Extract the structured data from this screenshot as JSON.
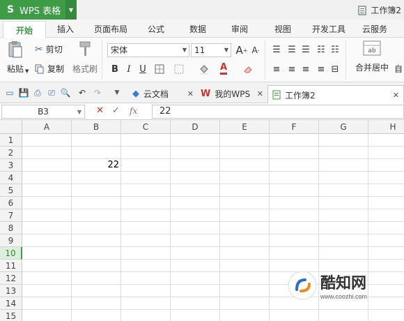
{
  "app": {
    "title": "WPS 表格",
    "logo": "S"
  },
  "window": {
    "doc_title": "工作簿2"
  },
  "ribbon_tabs": [
    "开始",
    "插入",
    "页面布局",
    "公式",
    "数据",
    "审阅",
    "视图",
    "开发工具",
    "云服务"
  ],
  "ribbon": {
    "paste": "粘贴",
    "cut": "剪切",
    "copy": "复制",
    "format_painter": "格式刷",
    "font_name": "宋体",
    "font_size": "11",
    "merge_center": "合并居中",
    "bold": "B",
    "italic": "I",
    "underline": "U",
    "grow_font": "A",
    "shrink_font": "A",
    "auto_label": "自"
  },
  "doc_tabs": [
    {
      "label": "云文档"
    },
    {
      "label": "我的WPS"
    },
    {
      "label": "工作簿2"
    }
  ],
  "formula_bar": {
    "name_box": "B3",
    "fx": "fx",
    "value": "22"
  },
  "columns": [
    "A",
    "B",
    "C",
    "D",
    "E",
    "F",
    "G",
    "H"
  ],
  "rows": [
    "1",
    "2",
    "3",
    "4",
    "5",
    "6",
    "7",
    "8",
    "9",
    "10",
    "11",
    "12",
    "13",
    "14",
    "15"
  ],
  "selected_row": "10",
  "cells": {
    "B3": "22"
  },
  "watermark": {
    "name": "酷知网",
    "url": "www.coozhi.com"
  },
  "colors": {
    "accent": "#3e9b46",
    "wps_red": "#d0312d",
    "font_color": "#d0312d"
  }
}
